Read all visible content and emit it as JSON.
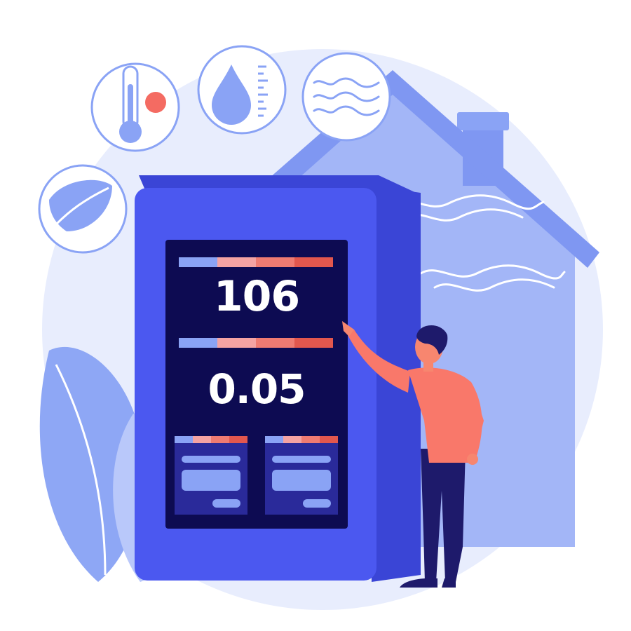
{
  "colors": {
    "background": "#ffffff",
    "backdrop_circle": "#e8edfd",
    "house": "#a3b6f7",
    "house_dark": "#7f97f2",
    "device_front": "#4b58f0",
    "device_side": "#3a45d6",
    "screen": "#0d0b52",
    "bar_blue": "#8aa3f5",
    "bar_pink": "#f4a3a3",
    "bar_coral": "#ef7b72",
    "bar_red": "#e2574e",
    "person_shirt": "#f9786a",
    "person_pants": "#1e1a6b",
    "person_skin": "#f7866f",
    "person_hair": "#1e1a6b",
    "icon_stroke": "#8aa3f5",
    "warm_dot": "#f46b62"
  },
  "device": {
    "reading_primary": "106",
    "reading_secondary": "0.05"
  },
  "icons": [
    {
      "name": "thermometer-icon"
    },
    {
      "name": "water-drop-icon"
    },
    {
      "name": "air-waves-icon"
    },
    {
      "name": "leaf-icon"
    }
  ]
}
